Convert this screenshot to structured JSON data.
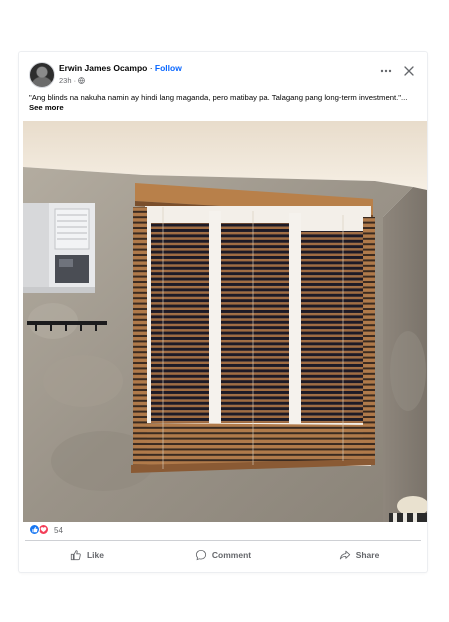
{
  "post": {
    "author": "Erwin James Ocampo",
    "separator": " · ",
    "follow_label": "Follow",
    "time": "23h · ",
    "caption": "\"Ang blinds na nakuha namin ay hindi lang maganda, pero matibay pa. Talagang pang long-term investment.\"...",
    "see_more": "See more"
  },
  "reactions": {
    "icons": [
      "like-icon",
      "love-icon"
    ],
    "count": "54"
  },
  "actions": {
    "like": "Like",
    "comment": "Comment",
    "share": "Share"
  },
  "colors": {
    "accent": "#0866ff",
    "like": "#1877f2",
    "love": "#f33e58",
    "secondary_text": "#65676b",
    "wall": "#9c968c",
    "blinds": "#b07a4a"
  }
}
